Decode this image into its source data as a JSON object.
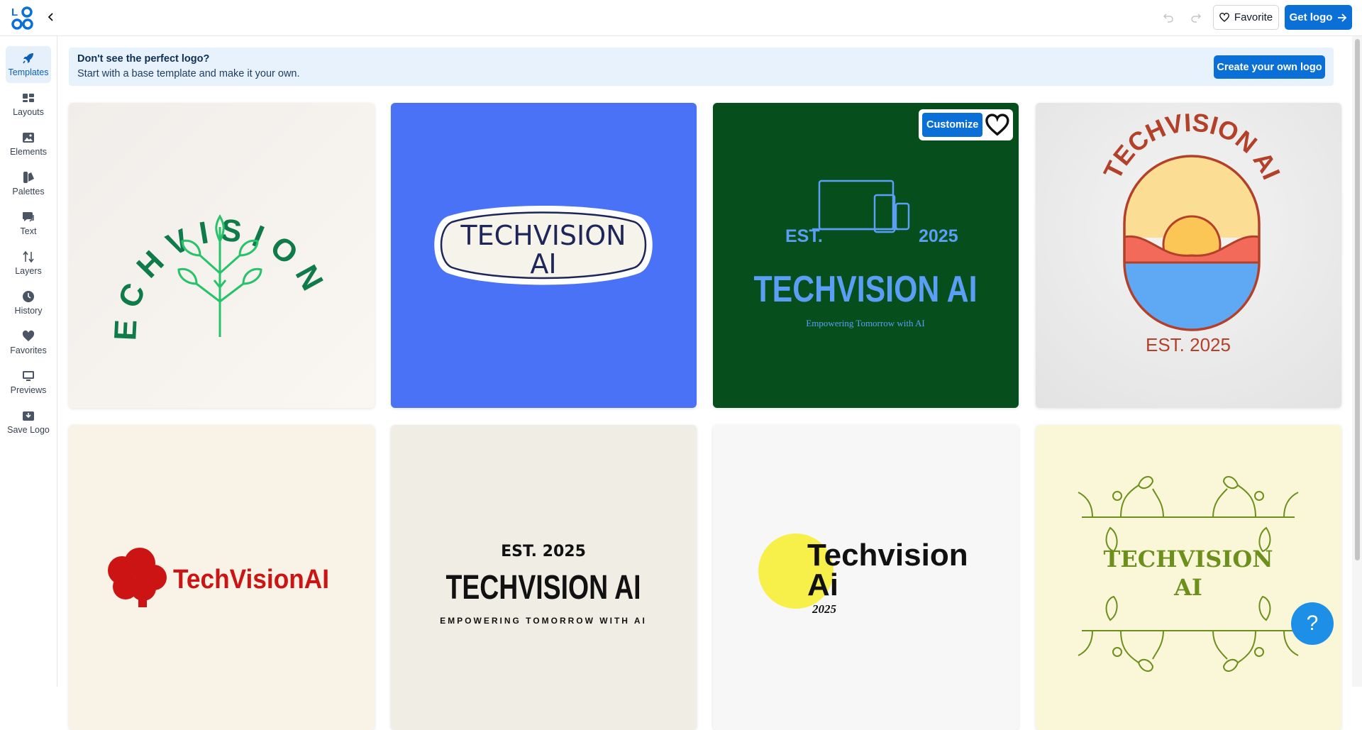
{
  "app": {
    "logo_text": "LOGO"
  },
  "toolbar": {
    "back_icon": "chevron-left-icon",
    "favorite_label": "Favorite",
    "get_logo_label": "Get logo"
  },
  "sidebar": {
    "items": [
      {
        "label": "Templates",
        "icon": "rocket-icon",
        "active": true
      },
      {
        "label": "Layouts",
        "icon": "layouts-icon"
      },
      {
        "label": "Elements",
        "icon": "image-icon"
      },
      {
        "label": "Palettes",
        "icon": "palette-icon"
      },
      {
        "label": "Text",
        "icon": "chat-bubble-icon"
      },
      {
        "label": "Layers",
        "icon": "layers-arrows-icon"
      },
      {
        "label": "History",
        "icon": "clock-icon"
      },
      {
        "label": "Favorites",
        "icon": "heart-icon"
      },
      {
        "label": "Previews",
        "icon": "monitor-icon"
      },
      {
        "label": "Save Logo",
        "icon": "download-box-icon"
      }
    ]
  },
  "banner": {
    "title": "Don't see the perfect logo?",
    "subtitle": "Start with a base template and make it your own.",
    "button_label": "Create your own logo"
  },
  "cards": [
    {
      "text": "TECHVISION AI",
      "bg": "#f3efec",
      "accent": "#0f7a4a"
    },
    {
      "line1": "TECHVISION",
      "line2": "AI",
      "bg": "#4a72f6",
      "accent": "#1d2559"
    },
    {
      "est": "EST.",
      "year": "2025",
      "name": "TECHVISION AI",
      "tagline": "Empowering Tomorrow with AI",
      "bg": "#064f1c",
      "accent": "#5b9ef5",
      "customize_label": "Customize"
    },
    {
      "name": "TECHVISION AI",
      "est": "EST. 2025",
      "bg": "#ebebeb",
      "accent": "#b3412a"
    },
    {
      "name": "TechVisionAI",
      "bg": "#f8f3e6",
      "accent": "#cc1414"
    },
    {
      "est": "EST. 2025",
      "name": "TECHVISION AI",
      "tagline": "EMPOWERING TOMORROW WITH AI",
      "bg": "#efede4",
      "accent": "#111111"
    },
    {
      "line1": "Techvision",
      "line2": "Ai",
      "year": "2025",
      "bg": "#f7f7f7",
      "accent": "#f7f04a"
    },
    {
      "line1": "TECHVISION",
      "line2": "AI",
      "bg": "#faf6d8",
      "accent": "#6d8f1c"
    }
  ],
  "help": {
    "label": "?"
  }
}
